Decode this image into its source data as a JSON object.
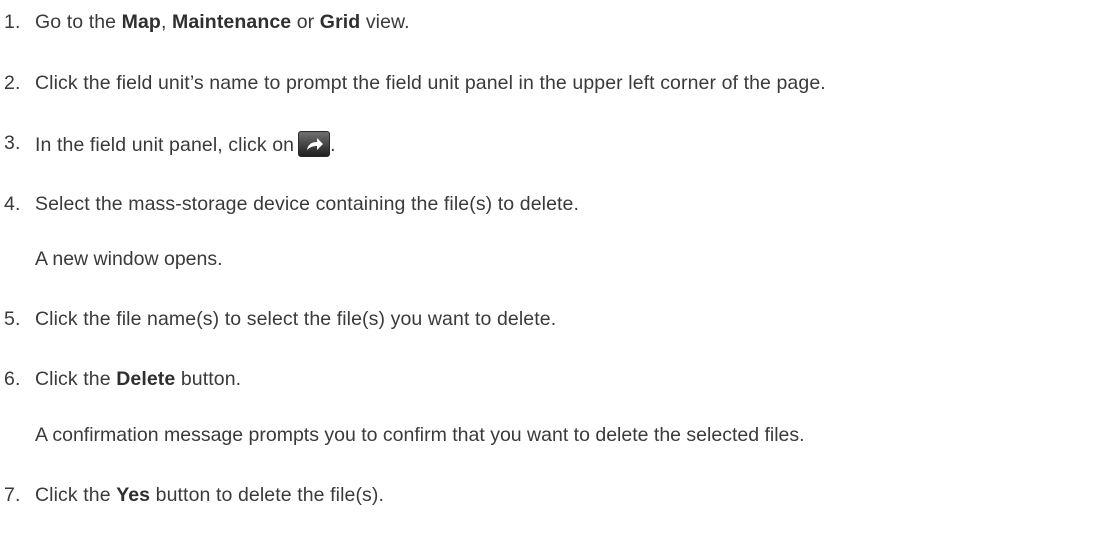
{
  "steps": [
    {
      "number": "1.",
      "parts": [
        "Go to the ",
        "Map",
        ", ",
        "Maintenance",
        " or ",
        "Grid",
        " view."
      ]
    },
    {
      "number": "2.",
      "text": "Click the field unit’s name to prompt the field unit panel in the upper left corner of the page."
    },
    {
      "number": "3.",
      "before": "In the field unit panel, click on",
      "after": ".",
      "icon": "forward-arrow-icon"
    },
    {
      "number": "4.",
      "text": "Select the mass-storage device containing the file(s) to delete.",
      "note": "A new window opens."
    },
    {
      "number": "5.",
      "text": "Click the file name(s) to select the file(s) you want to delete."
    },
    {
      "number": "6.",
      "parts": [
        "Click the ",
        "Delete",
        " button."
      ],
      "note": "A confirmation message prompts you to confirm that you want to delete the selected files."
    },
    {
      "number": "7.",
      "parts": [
        "Click the ",
        "Yes",
        " button to delete the file(s)."
      ]
    }
  ]
}
